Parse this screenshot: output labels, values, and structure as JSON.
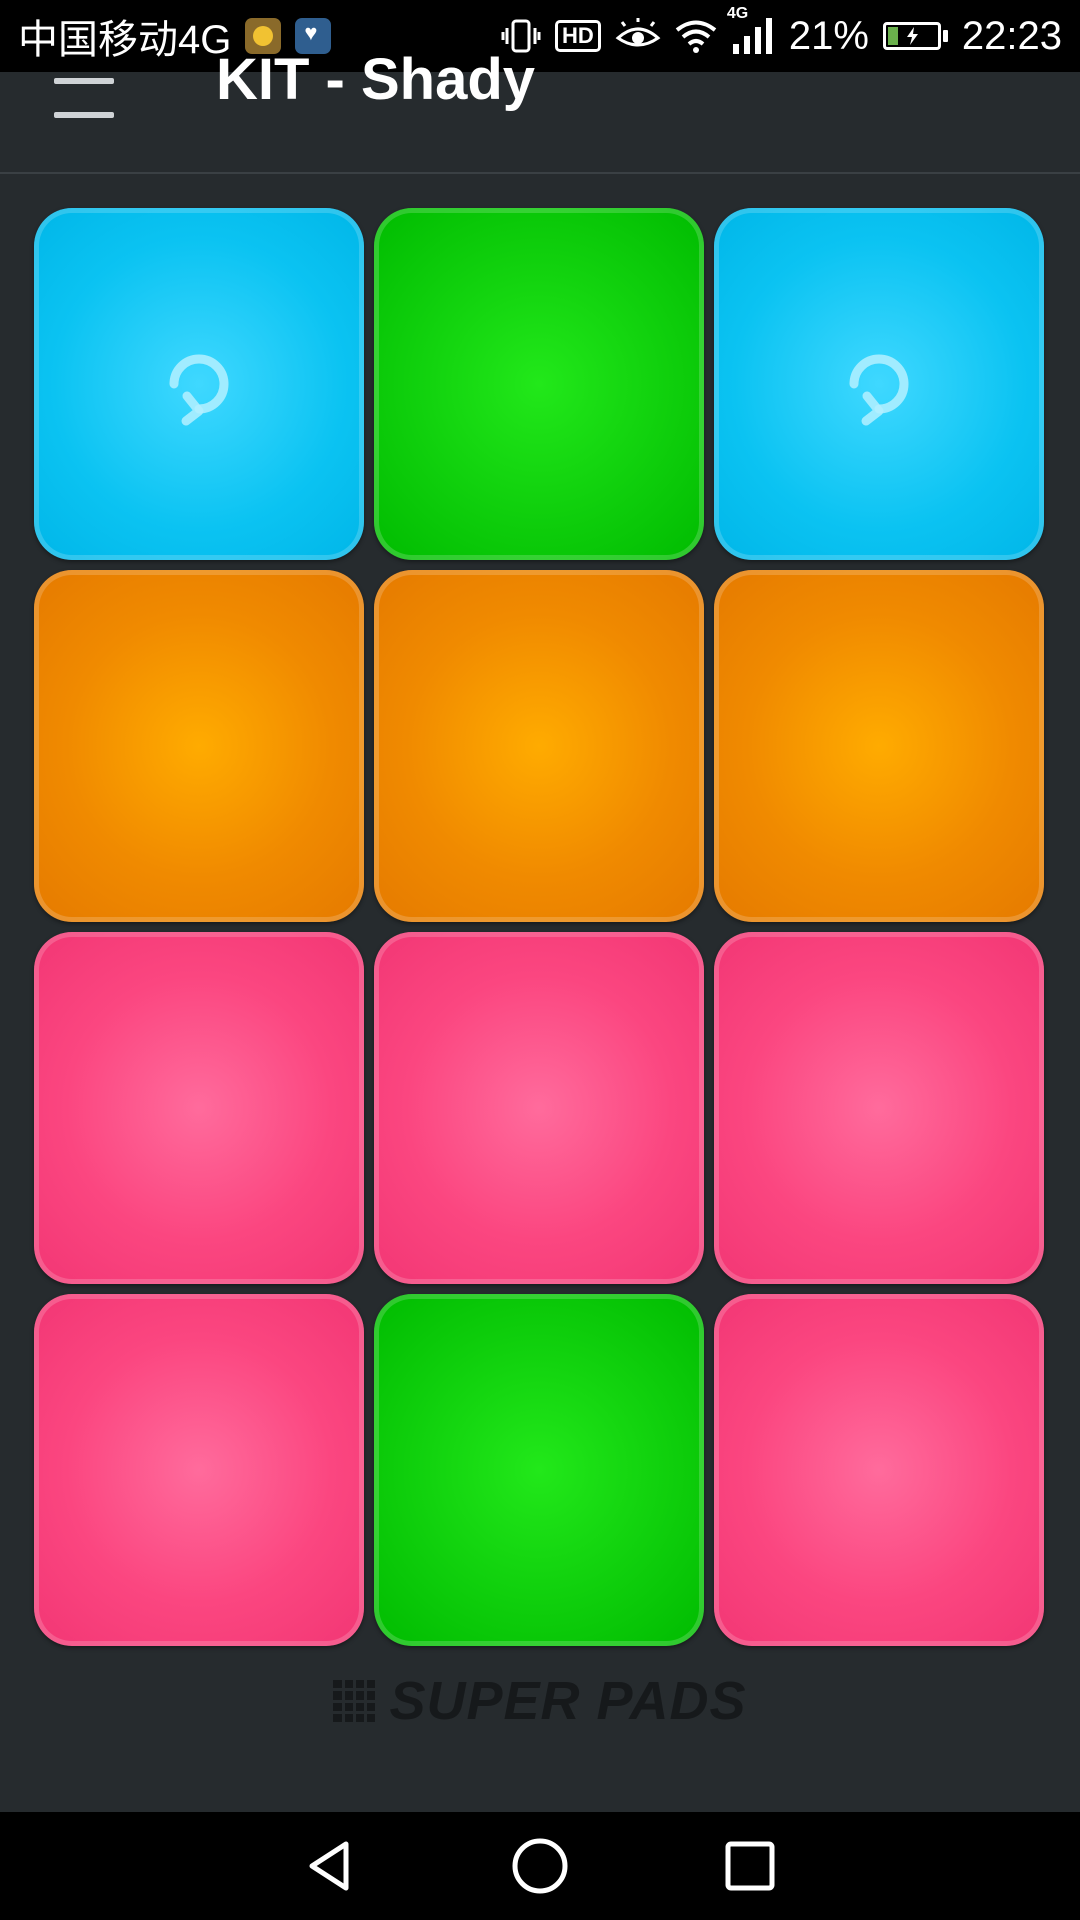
{
  "status_bar": {
    "carrier": "中国移动4G",
    "network_badge": "4G",
    "hd_label": "HD",
    "battery_percent": "21%",
    "battery_level": 0.21,
    "time": "22:23",
    "icons": [
      "music-app-icon",
      "health-app-icon",
      "vibrate-icon",
      "hd-icon",
      "eye-icon",
      "wifi-icon",
      "signal-icon",
      "battery-icon"
    ]
  },
  "app_bar": {
    "title": "KIT - Shady"
  },
  "pads": [
    {
      "color": "blue",
      "icon": "loop-icon"
    },
    {
      "color": "green",
      "icon": ""
    },
    {
      "color": "blue",
      "icon": "loop-icon"
    },
    {
      "color": "orange",
      "icon": ""
    },
    {
      "color": "orange",
      "icon": ""
    },
    {
      "color": "orange",
      "icon": ""
    },
    {
      "color": "pink",
      "icon": ""
    },
    {
      "color": "pink",
      "icon": ""
    },
    {
      "color": "pink",
      "icon": ""
    },
    {
      "color": "pink",
      "icon": ""
    },
    {
      "color": "green",
      "icon": ""
    },
    {
      "color": "pink",
      "icon": ""
    }
  ],
  "colors": {
    "blue": "#0bc3f2",
    "green": "#0fcf0c",
    "orange": "#f08a00",
    "pink": "#fb4680",
    "background": "#262b2e"
  },
  "brand": {
    "name": "SUPER PADS"
  },
  "nav": {
    "buttons": [
      "back-icon",
      "home-icon",
      "recents-icon"
    ]
  }
}
